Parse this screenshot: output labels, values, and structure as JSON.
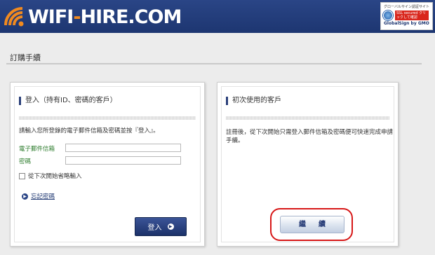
{
  "header": {
    "logo_text": "WIFI-HIRE.COM",
    "logo_part1": "WIFI",
    "logo_dash": "-",
    "logo_part2": "HIRE.COM"
  },
  "ssl_badge": {
    "caption": "グローバルサイン認証サイト",
    "box_text": "SSL secured クリックして確認",
    "brand": "GlobalSign",
    "brand_suffix": "by GMO"
  },
  "page": {
    "title": "訂購手續"
  },
  "login_panel": {
    "heading": "登入（持有ID、密碼的客戶）",
    "description": "請輸入您所登錄的電子郵件信箱及密碼並按『登入』。",
    "email_label": "電子郵件信箱",
    "email_value": "",
    "password_label": "密碼",
    "password_value": "",
    "remember_label": "從下次開始省略輸入",
    "forgot_label": "忘記密碼",
    "login_button": "登入"
  },
  "new_customer_panel": {
    "heading": "初次使用的客戶",
    "description_line1": "註冊後，從下次開始只需登入郵件信箱及密碼便可快速完成申請",
    "description_line2": "手續。",
    "continue_button": "繼續"
  },
  "colors": {
    "header_bg": "#1d3671",
    "accent_orange": "#f28a1f",
    "button_navy": "#1c326a",
    "label_green": "#2b7b2b",
    "highlight_red": "#d71818"
  }
}
